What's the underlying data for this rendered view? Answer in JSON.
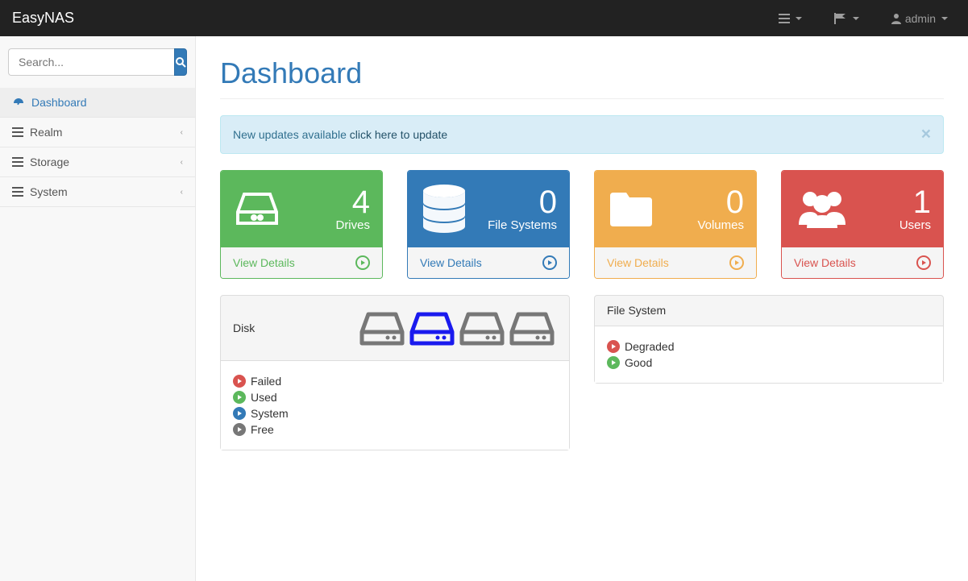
{
  "brand": "EasyNAS",
  "navbar": {
    "user_label": "admin"
  },
  "search": {
    "placeholder": "Search..."
  },
  "sidebar": {
    "items": [
      {
        "label": "Dashboard"
      },
      {
        "label": "Realm"
      },
      {
        "label": "Storage"
      },
      {
        "label": "System"
      }
    ]
  },
  "page": {
    "title": "Dashboard"
  },
  "alert": {
    "text": "New updates available ",
    "link": "click here to update"
  },
  "stats": {
    "view_details": "View Details",
    "drives": {
      "value": "4",
      "label": "Drives"
    },
    "filesystems": {
      "value": "0",
      "label": "File Systems"
    },
    "volumes": {
      "value": "0",
      "label": "Volumes"
    },
    "users": {
      "value": "1",
      "label": "Users"
    }
  },
  "disk_card": {
    "title": "Disk",
    "legend": {
      "failed": "Failed",
      "used": "Used",
      "system": "System",
      "free": "Free"
    }
  },
  "fs_card": {
    "title": "File System",
    "degraded": "Degraded",
    "good": "Good"
  }
}
